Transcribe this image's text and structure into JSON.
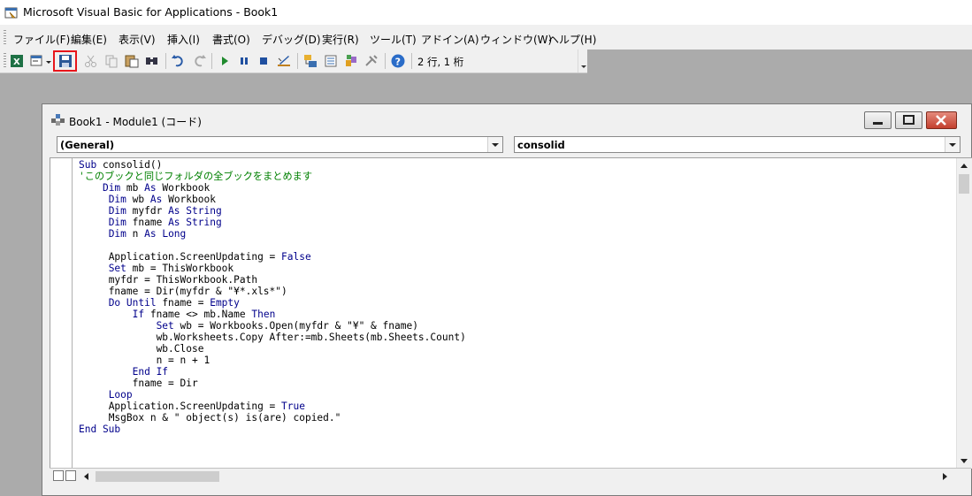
{
  "app": {
    "title": "Microsoft Visual Basic for Applications - Book1"
  },
  "menu": [
    {
      "label": "ファイル(F)"
    },
    {
      "label": "編集(E)"
    },
    {
      "label": "表示(V)"
    },
    {
      "label": "挿入(I)"
    },
    {
      "label": "書式(O)"
    },
    {
      "label": "デバッグ(D)"
    },
    {
      "label": "実行(R)"
    },
    {
      "label": "ツール(T)"
    },
    {
      "label": "アドイン(A)"
    },
    {
      "label": "ウィンドウ(W)"
    },
    {
      "label": "ヘルプ(H)"
    }
  ],
  "toolbar": {
    "cursor_position": "2 行, 1 桁",
    "buttons": [
      "view-excel-icon",
      "insert-userform-icon",
      "save-icon",
      "cut-icon",
      "copy-icon",
      "paste-icon",
      "find-icon",
      "undo-icon",
      "redo-icon",
      "run-icon",
      "break-icon",
      "reset-icon",
      "design-mode-icon",
      "project-explorer-icon",
      "properties-icon",
      "object-browser-icon",
      "toolbox-icon",
      "help-icon"
    ],
    "highlight_color": "#e8151b"
  },
  "code_window": {
    "title": "Book1 - Module1 (コード)",
    "object_combo": "(General)",
    "procedure_combo": "consolid",
    "lines": [
      {
        "indent": "",
        "parts": [
          [
            "kw",
            "Sub "
          ],
          [
            "t",
            "consolid()"
          ]
        ]
      },
      {
        "indent": "",
        "parts": [
          [
            "cm",
            "'このブックと同じフォルダの全ブックをまとめます"
          ]
        ]
      },
      {
        "indent": "    ",
        "parts": [
          [
            "kw",
            "Dim "
          ],
          [
            "t",
            "mb "
          ],
          [
            "kw",
            "As "
          ],
          [
            "t",
            "Workbook"
          ]
        ]
      },
      {
        "indent": "     ",
        "parts": [
          [
            "kw",
            "Dim "
          ],
          [
            "t",
            "wb "
          ],
          [
            "kw",
            "As "
          ],
          [
            "t",
            "Workbook"
          ]
        ]
      },
      {
        "indent": "     ",
        "parts": [
          [
            "kw",
            "Dim "
          ],
          [
            "t",
            "myfdr "
          ],
          [
            "kw",
            "As String"
          ]
        ]
      },
      {
        "indent": "     ",
        "parts": [
          [
            "kw",
            "Dim "
          ],
          [
            "t",
            "fname "
          ],
          [
            "kw",
            "As String"
          ]
        ]
      },
      {
        "indent": "     ",
        "parts": [
          [
            "kw",
            "Dim "
          ],
          [
            "t",
            "n "
          ],
          [
            "kw",
            "As Long"
          ]
        ]
      },
      {
        "indent": "",
        "parts": []
      },
      {
        "indent": "     ",
        "parts": [
          [
            "t",
            "Application.ScreenUpdating = "
          ],
          [
            "kw",
            "False"
          ]
        ]
      },
      {
        "indent": "     ",
        "parts": [
          [
            "kw",
            "Set "
          ],
          [
            "t",
            "mb = ThisWorkbook"
          ]
        ]
      },
      {
        "indent": "     ",
        "parts": [
          [
            "t",
            "myfdr = ThisWorkbook.Path"
          ]
        ]
      },
      {
        "indent": "     ",
        "parts": [
          [
            "t",
            "fname = Dir(myfdr & \"¥*.xls*\")"
          ]
        ]
      },
      {
        "indent": "     ",
        "parts": [
          [
            "kw",
            "Do Until "
          ],
          [
            "t",
            "fname = "
          ],
          [
            "kw",
            "Empty"
          ]
        ]
      },
      {
        "indent": "         ",
        "parts": [
          [
            "kw",
            "If "
          ],
          [
            "t",
            "fname <> mb.Name "
          ],
          [
            "kw",
            "Then"
          ]
        ]
      },
      {
        "indent": "             ",
        "parts": [
          [
            "kw",
            "Set "
          ],
          [
            "t",
            "wb = Workbooks.Open(myfdr & \"¥\" & fname)"
          ]
        ]
      },
      {
        "indent": "             ",
        "parts": [
          [
            "t",
            "wb.Worksheets.Copy After:=mb.Sheets(mb.Sheets.Count)"
          ]
        ]
      },
      {
        "indent": "             ",
        "parts": [
          [
            "t",
            "wb.Close"
          ]
        ]
      },
      {
        "indent": "             ",
        "parts": [
          [
            "t",
            "n = n + 1"
          ]
        ]
      },
      {
        "indent": "         ",
        "parts": [
          [
            "kw",
            "End If"
          ]
        ]
      },
      {
        "indent": "         ",
        "parts": [
          [
            "t",
            "fname = Dir"
          ]
        ]
      },
      {
        "indent": "     ",
        "parts": [
          [
            "kw",
            "Loop"
          ]
        ]
      },
      {
        "indent": "     ",
        "parts": [
          [
            "t",
            "Application.ScreenUpdating = "
          ],
          [
            "kw",
            "True"
          ]
        ]
      },
      {
        "indent": "     ",
        "parts": [
          [
            "t",
            "MsgBox n & \" object(s) is(are) copied.\""
          ]
        ]
      },
      {
        "indent": "",
        "parts": [
          [
            "kw",
            "End Sub"
          ]
        ]
      }
    ]
  }
}
